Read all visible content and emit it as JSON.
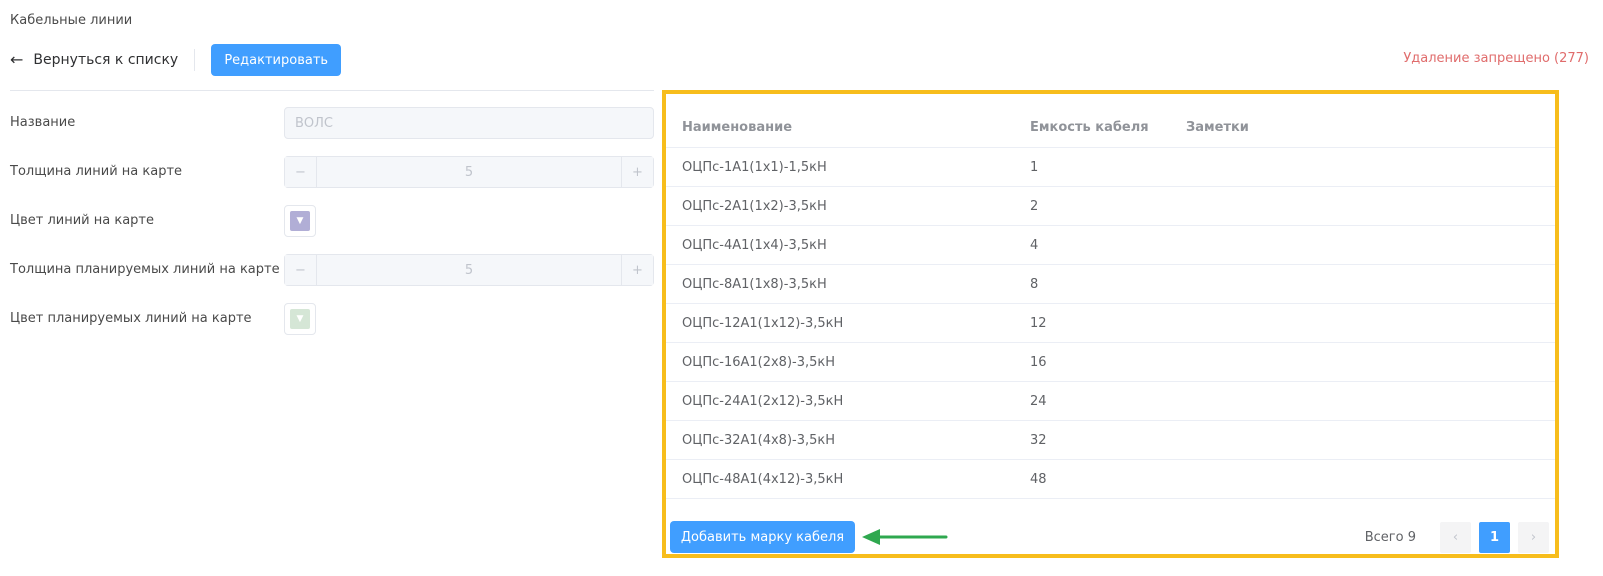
{
  "header": {
    "title": "Кабельные линии",
    "back_label": "Вернуться к списку",
    "edit_label": "Редактировать",
    "delete_note": "Удаление запрещено (277)"
  },
  "form": {
    "name_label": "Название",
    "name_value": "ВОЛС",
    "line_width_label": "Толщина линий на карте",
    "line_width_value": "5",
    "line_color_label": "Цвет линий на карте",
    "line_color": "#b1aed6",
    "planned_width_label": "Толщина планируемых линий на карте",
    "planned_width_value": "5",
    "planned_color_label": "Цвет планируемых линий на карте",
    "planned_color": "#d5e6d6",
    "minus_symbol": "−",
    "plus_symbol": "+"
  },
  "table": {
    "columns": [
      "Наименование",
      "Емкость кабеля",
      "Заметки"
    ],
    "rows": [
      {
        "name": "ОЦПс-1А1(1х1)-1,5кН",
        "capacity": "1",
        "notes": ""
      },
      {
        "name": "ОЦПс-2А1(1х2)-3,5кН",
        "capacity": "2",
        "notes": ""
      },
      {
        "name": "ОЦПс-4А1(1х4)-3,5кН",
        "capacity": "4",
        "notes": ""
      },
      {
        "name": "ОЦПс-8А1(1х8)-3,5кН",
        "capacity": "8",
        "notes": ""
      },
      {
        "name": "ОЦПс-12А1(1х12)-3,5кН",
        "capacity": "12",
        "notes": ""
      },
      {
        "name": "ОЦПс-16А1(2х8)-3,5кН",
        "capacity": "16",
        "notes": ""
      },
      {
        "name": "ОЦПс-24А1(2х12)-3,5кН",
        "capacity": "24",
        "notes": ""
      },
      {
        "name": "ОЦПс-32А1(4х8)-3,5кН",
        "capacity": "32",
        "notes": ""
      },
      {
        "name": "ОЦПс-48А1(4х12)-3,5кН",
        "capacity": "48",
        "notes": ""
      }
    ]
  },
  "footer": {
    "add_label": "Добавить марку кабеля",
    "total_label": "Всего 9",
    "prev_symbol": "‹",
    "next_symbol": "›",
    "current_page": "1"
  },
  "colors": {
    "primary": "#409eff",
    "highlight_border": "#f7bd1c",
    "annotation_arrow": "#2fa84f",
    "delete_note": "#e06c6c"
  },
  "icons": {
    "back": "arrow-left-icon",
    "annotation": "green-arrow-icon",
    "dropdown": "chevron-down-icon"
  }
}
